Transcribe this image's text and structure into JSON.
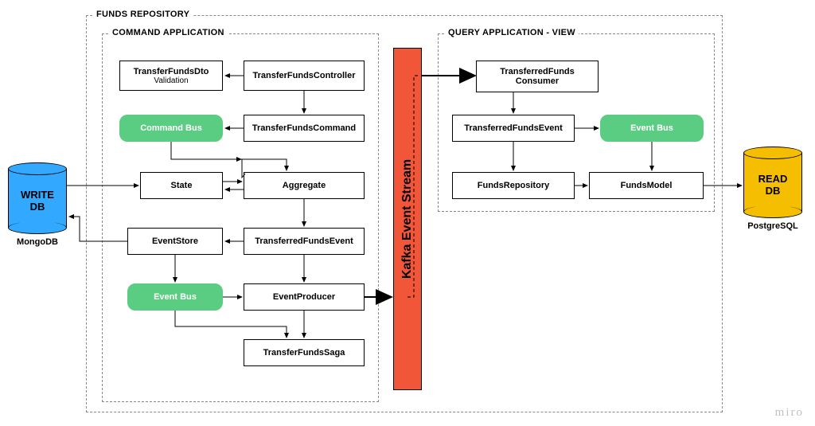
{
  "repo": {
    "label": "FUNDS REPOSITORY"
  },
  "cmd": {
    "label": "COMMAND APPLICATION",
    "dto": "TransferFundsDto",
    "dto_sub": "Validation",
    "controller": "TransferFundsController",
    "commandBus": "Command Bus",
    "command": "TransferFundsCommand",
    "state": "State",
    "aggregate": "Aggregate",
    "eventStore": "EventStore",
    "tfe": "TransferredFundsEvent",
    "eventBus": "Event Bus",
    "producer": "EventProducer",
    "saga": "TransferFundsSaga"
  },
  "kafka": "Kafka Event Stream",
  "qry": {
    "label": "QUERY APPLICATION - VIEW",
    "consumer": "TransferredFunds\nConsumer",
    "consumer_l1": "TransferredFunds",
    "consumer_l2": "Consumer",
    "tfe": "TransferredFundsEvent",
    "eventBus": "Event Bus",
    "repo": "FundsRepository",
    "model": "FundsModel"
  },
  "writeDb": {
    "title": "WRITE\nDB",
    "title_l1": "WRITE",
    "title_l2": "DB",
    "engine": "MongoDB"
  },
  "readDb": {
    "title": "READ\nDB",
    "title_l1": "READ",
    "title_l2": "DB",
    "engine": "PostgreSQL"
  },
  "watermark": "miro",
  "colors": {
    "bus": "#5bcd82",
    "kafka": "#f15638",
    "write": "#33a8ff",
    "read": "#f5be00"
  }
}
